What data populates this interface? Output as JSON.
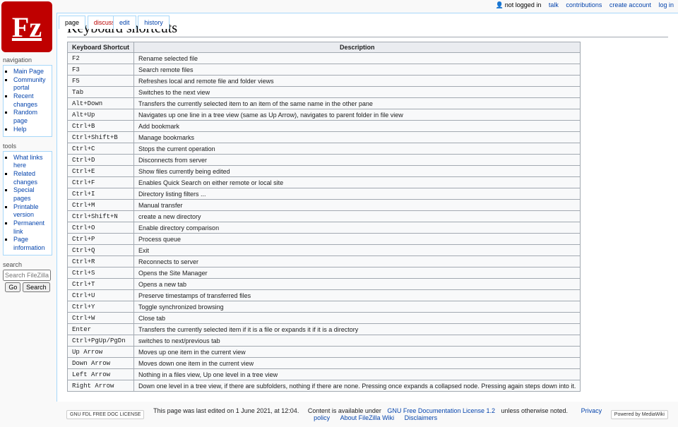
{
  "personal": {
    "not_logged_in": "not logged in",
    "talk": "talk",
    "contributions": "contributions",
    "create_account": "create account",
    "log_in": "log in"
  },
  "tabs": {
    "page": "page",
    "discussion": "discussion",
    "edit": "edit",
    "history": "history"
  },
  "heading": "Keyboard shortcuts",
  "nav": {
    "title": "navigation",
    "items": [
      "Main Page",
      "Community portal",
      "Recent changes",
      "Random page",
      "Help"
    ]
  },
  "tools": {
    "title": "tools",
    "items": [
      "What links here",
      "Related changes",
      "Special pages",
      "Printable version",
      "Permanent link",
      "Page information"
    ]
  },
  "search": {
    "title": "search",
    "placeholder": "Search FileZilla Wiki",
    "go": "Go",
    "search_btn": "Search"
  },
  "table": {
    "headers": [
      "Keyboard Shortcut",
      "Description"
    ],
    "rows": [
      [
        "F2",
        "Rename selected file"
      ],
      [
        "F3",
        "Search remote files"
      ],
      [
        "F5",
        "Refreshes local and remote file and folder views"
      ],
      [
        "Tab",
        "Switches to the next view"
      ],
      [
        "Alt+Down",
        "Transfers the currently selected item to an item of the same name in the other pane"
      ],
      [
        "Alt+Up",
        "Navigates up one line in a tree view (same as Up Arrow), navigates to parent folder in file view"
      ],
      [
        "Ctrl+B",
        "Add bookmark"
      ],
      [
        "Ctrl+Shift+B",
        "Manage bookmarks"
      ],
      [
        "Ctrl+C",
        "Stops the current operation"
      ],
      [
        "Ctrl+D",
        "Disconnects from server"
      ],
      [
        "Ctrl+E",
        "Show files currently being edited"
      ],
      [
        "Ctrl+F",
        "Enables Quick Search on either remote or local site"
      ],
      [
        "Ctrl+I",
        "Directory listing filters ..."
      ],
      [
        "Ctrl+M",
        "Manual transfer"
      ],
      [
        "Ctrl+Shift+N",
        "create a new directory"
      ],
      [
        "Ctrl+O",
        "Enable directory comparison"
      ],
      [
        "Ctrl+P",
        "Process queue"
      ],
      [
        "Ctrl+Q",
        "Exit"
      ],
      [
        "Ctrl+R",
        "Reconnects to server"
      ],
      [
        "Ctrl+S",
        "Opens the Site Manager"
      ],
      [
        "Ctrl+T",
        "Opens a new tab"
      ],
      [
        "Ctrl+U",
        "Preserve timestamps of transferred files"
      ],
      [
        "Ctrl+Y",
        "Toggle synchronized browsing"
      ],
      [
        "Ctrl+W",
        "Close tab"
      ],
      [
        "Enter",
        "Transfers the currently selected item if it is a file or expands it if it is a directory"
      ],
      [
        "Ctrl+PgUp/PgDn",
        "switches to next/previous tab"
      ],
      [
        "Up Arrow",
        "Moves up one item in the current view"
      ],
      [
        "Down Arrow",
        "Moves down one item in the current view"
      ],
      [
        "Left Arrow",
        "Nothing in a files view, Up one level in a tree view"
      ],
      [
        "Right Arrow",
        "Down one level in a tree view, if there are subfolders, nothing if there are none. Pressing once expands a collapsed node. Pressing again steps down into it."
      ]
    ]
  },
  "footer": {
    "lastmod": "This page was last edited on 1 June 2021, at 12:04.",
    "content_prefix": "Content is available under ",
    "license": "GNU Free Documentation License 1.2",
    "content_suffix": " unless otherwise noted.",
    "privacy": "Privacy policy",
    "about": "About FileZilla Wiki",
    "disclaimers": "Disclaimers",
    "gfdl_badge": "GNU FDL FREE DOC LICENSE",
    "mw_badge": "Powered by MediaWiki"
  }
}
